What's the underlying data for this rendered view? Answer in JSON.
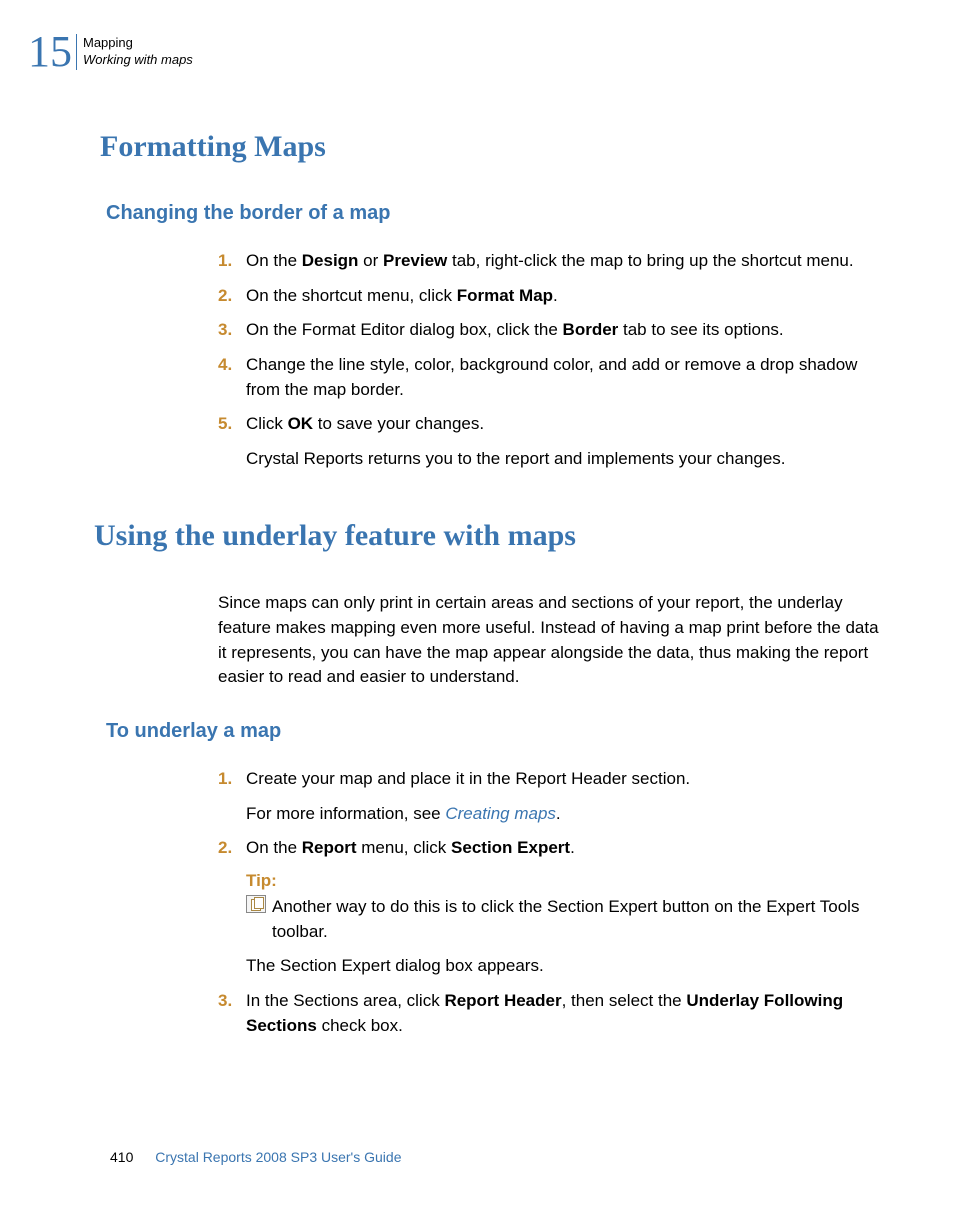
{
  "header": {
    "chapter_number": "15",
    "line1": "Mapping",
    "line2": "Working with maps"
  },
  "section1": {
    "title": "Formatting Maps",
    "subtitle": "Changing the border of a map",
    "steps": {
      "s1_a": "On the ",
      "s1_b": "Design",
      "s1_c": " or ",
      "s1_d": "Preview",
      "s1_e": " tab, right-click the map to bring up the shortcut menu.",
      "s2_a": "On the shortcut menu, click ",
      "s2_b": "Format Map",
      "s2_c": ".",
      "s3_a": "On the Format Editor dialog box, click the ",
      "s3_b": "Border",
      "s3_c": " tab to see its options.",
      "s4": "Change the line style, color, background color, and add or remove a drop shadow from the map border.",
      "s5_a": "Click ",
      "s5_b": "OK",
      "s5_c": " to save your changes."
    },
    "after": "Crystal Reports returns you to the report and implements your changes."
  },
  "section2": {
    "title": "Using the underlay feature with maps",
    "intro": "Since maps can only print in certain areas and sections of your report, the underlay feature makes mapping even more useful. Instead of having a map print before the data it represents, you can have the map appear alongside the data, thus making the report easier to read and easier to understand.",
    "subtitle": "To underlay a map",
    "steps": {
      "s1": "Create your map and place it in the Report Header section.",
      "s1_more_a": "For more information, see ",
      "s1_more_link": "Creating maps",
      "s1_more_b": ".",
      "s2_a": "On the ",
      "s2_b": "Report",
      "s2_c": " menu, click ",
      "s2_d": "Section Expert",
      "s2_e": ".",
      "tip_label": "Tip:",
      "tip_text": " Another way to do this is to click the Section Expert button on the Expert Tools toolbar.",
      "s2_after": "The Section Expert dialog box appears.",
      "s3_a": "In the Sections area, click ",
      "s3_b": "Report Header",
      "s3_c": ", then select the ",
      "s3_d": "Underlay Following Sections",
      "s3_e": " check box."
    }
  },
  "footer": {
    "page": "410",
    "title": "Crystal Reports 2008 SP3 User's Guide"
  },
  "nums": {
    "n1": "1.",
    "n2": "2.",
    "n3": "3.",
    "n4": "4.",
    "n5": "5."
  }
}
